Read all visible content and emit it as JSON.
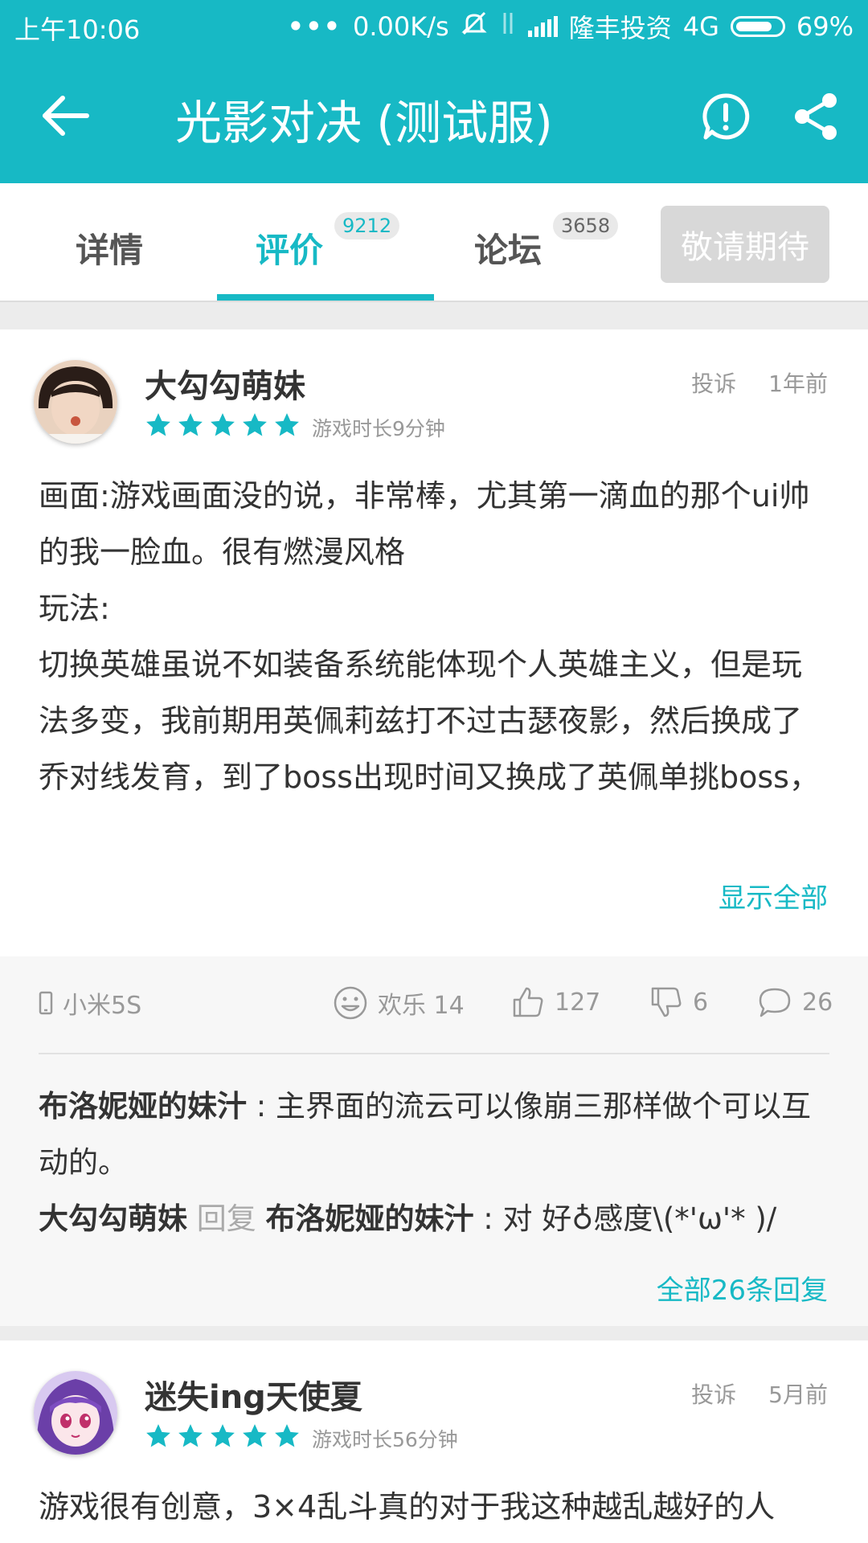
{
  "status_bar": {
    "time": "上午10:06",
    "dots": "•••",
    "speed": "0.00K/s",
    "carrier": "隆丰投资",
    "network": "4G",
    "battery": "69%"
  },
  "app_bar": {
    "title": "光影对决 (测试服)",
    "back_icon": "arrow-left-icon",
    "report_icon": "alert-circle-icon",
    "share_icon": "share-icon"
  },
  "tabs": [
    {
      "label": "详情",
      "badge": ""
    },
    {
      "label": "评价",
      "badge": "9212"
    },
    {
      "label": "论坛",
      "badge": "3658"
    }
  ],
  "expect_button": "敬请期待",
  "colors": {
    "accent": "#17b9c5",
    "star": "#17b9c5"
  },
  "reviews": [
    {
      "username": "大勾勾萌妹",
      "rating": 5,
      "playtime": "游戏时长9分钟",
      "report": "投诉",
      "time": "1年前",
      "content": [
        "画面:游戏画面没的说，非常棒，尤其第一滴血的那个ui帅的我一脸血。很有燃漫风格",
        "玩法:",
        "切换英雄虽说不如装备系统能体现个人英雄主义，但是玩法多变，我前期用英佩莉兹打不过古瑟夜影，然后换成了乔对线发育，到了boss出现时间又换成了英佩单挑boss，然后立马回家换成了古瑟带线牵制，一"
      ],
      "show_all": "显示全部",
      "device": "小米5S",
      "happy_label": "欢乐 14",
      "likes": "127",
      "dislikes": "6",
      "comments": "26",
      "replies": [
        {
          "author": "布洛妮娅的妹汁",
          "text": " : 主界面的流云可以像崩三那样做个可以互动的。"
        },
        {
          "author": "大勾勾萌妹",
          "reply_word": "回复",
          "target": "布洛妮娅的妹汁",
          "text": " : 对 好♁感度\\(*'ω'* )/"
        }
      ],
      "all_replies": "全部26条回复"
    },
    {
      "username": "迷失ing天使夏",
      "rating": 5,
      "playtime": "游戏时长56分钟",
      "report": "投诉",
      "time": "5月前",
      "content": [
        "游戏很有创意，3×4乱斗真的对于我这种越乱越好的人"
      ]
    }
  ]
}
